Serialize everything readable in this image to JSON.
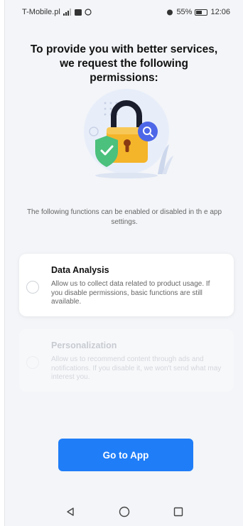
{
  "status_bar": {
    "carrier": "T-Mobile.pl",
    "battery": "55%",
    "time": "12:06"
  },
  "title": "To provide you with better services, we request the following permissions:",
  "description": "The following functions can be enabled or disabled in th e app settings.",
  "permissions": [
    {
      "title": "Data Analysis",
      "text": "Allow us to collect data related to product usage. If you disable permissions, basic functions are still available.",
      "state": "active"
    },
    {
      "title": "Personalization",
      "text": "Allow us to recommend content through ads and notifications. If you disable it, we won't send what may interest you.",
      "state": "disabled"
    }
  ],
  "go_button_label": "Go to App",
  "colors": {
    "accent": "#1f7df8",
    "lock_body": "#f5b52a",
    "shield": "#4cc07d",
    "magnifier": "#4e67e8"
  },
  "icons": [
    "signal-icon",
    "message-icon",
    "alarm-icon",
    "battery-icon",
    "lock-illustration",
    "shield-icon",
    "search-icon",
    "back-icon",
    "home-icon",
    "recents-icon"
  ]
}
